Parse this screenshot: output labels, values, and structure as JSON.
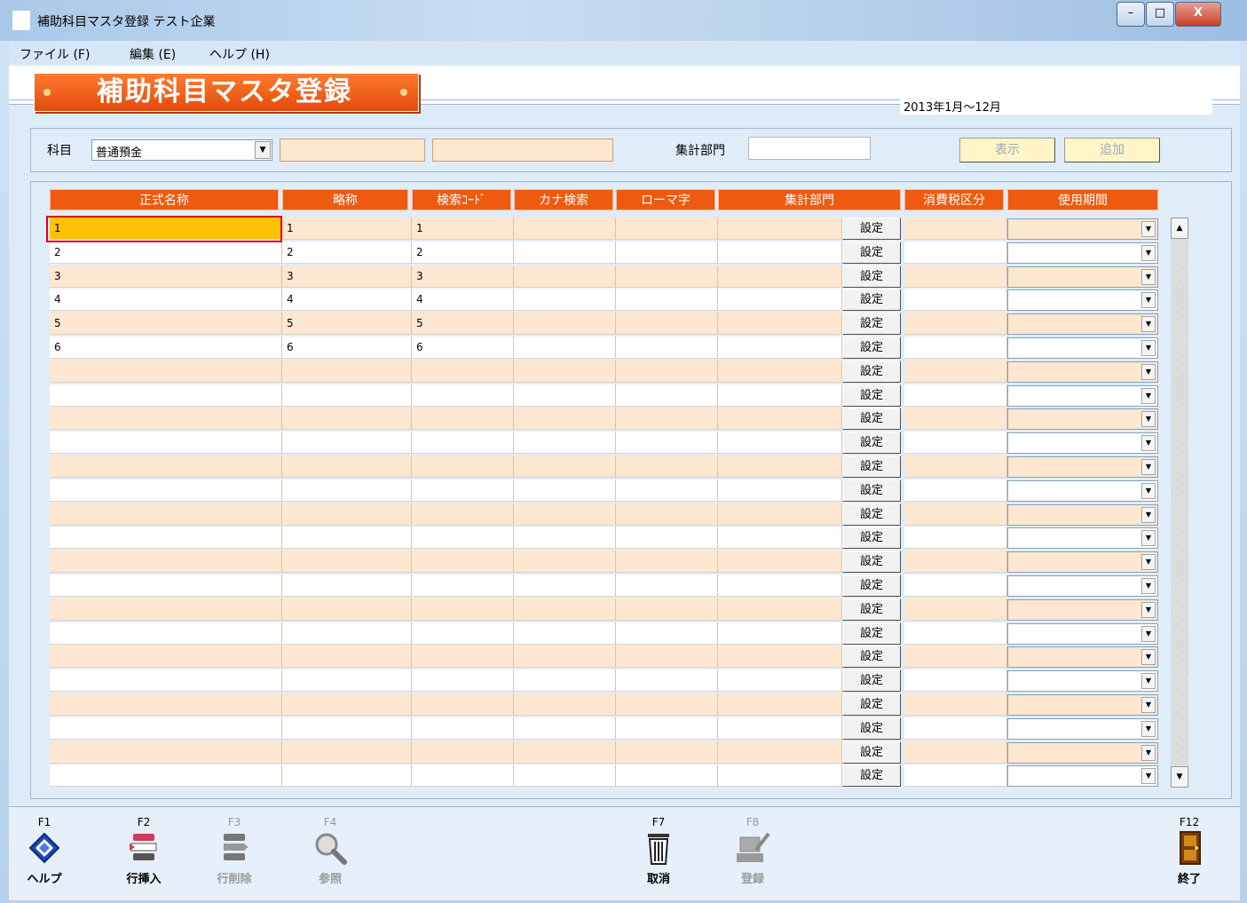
{
  "window": {
    "title": "補助科目マスタ登録 テスト企業",
    "minimize": "–",
    "maximize": "□",
    "close": "X"
  },
  "menu": {
    "file": "ファイル (F)",
    "edit": "編集 (E)",
    "help": "ヘルプ (H)"
  },
  "banner": {
    "title": "補助科目マスタ登録"
  },
  "period": "2013年1月〜12月",
  "filter": {
    "kamoku_label": "科目",
    "kamoku_value": "普通預金",
    "shukei_label": "集計部門",
    "show_button": "表示",
    "add_button": "追加"
  },
  "grid": {
    "headers": [
      "正式名称",
      "略称",
      "検索ｺｰﾄﾞ",
      "カナ検索",
      "ローマ字",
      "集計部門",
      "消費税区分",
      "使用期間"
    ],
    "set_label": "設定",
    "rows": [
      [
        "1",
        "1",
        "1"
      ],
      [
        "2",
        "2",
        "2"
      ],
      [
        "3",
        "3",
        "3"
      ],
      [
        "4",
        "4",
        "4"
      ],
      [
        "5",
        "5",
        "5"
      ],
      [
        "6",
        "6",
        "6"
      ],
      [
        "",
        "",
        ""
      ],
      [
        "",
        "",
        ""
      ],
      [
        "",
        "",
        ""
      ],
      [
        "",
        "",
        ""
      ],
      [
        "",
        "",
        ""
      ],
      [
        "",
        "",
        ""
      ],
      [
        "",
        "",
        ""
      ],
      [
        "",
        "",
        ""
      ],
      [
        "",
        "",
        ""
      ],
      [
        "",
        "",
        ""
      ],
      [
        "",
        "",
        ""
      ],
      [
        "",
        "",
        ""
      ],
      [
        "",
        "",
        ""
      ],
      [
        "",
        "",
        ""
      ],
      [
        "",
        "",
        ""
      ],
      [
        "",
        "",
        ""
      ],
      [
        "",
        "",
        ""
      ],
      [
        "",
        "",
        ""
      ]
    ]
  },
  "fkeys": [
    {
      "key": "F1",
      "label": "ヘルプ",
      "icon": "help-book-icon",
      "enabled": true
    },
    {
      "key": "F2",
      "label": "行挿入",
      "icon": "row-insert-icon",
      "enabled": true
    },
    {
      "key": "F3",
      "label": "行削除",
      "icon": "row-delete-icon",
      "enabled": false
    },
    {
      "key": "F4",
      "label": "参照",
      "icon": "magnifier-icon",
      "enabled": false
    },
    {
      "key": "F7",
      "label": "取消",
      "icon": "trash-icon",
      "enabled": true
    },
    {
      "key": "F8",
      "label": "登録",
      "icon": "register-icon",
      "enabled": false
    },
    {
      "key": "F12",
      "label": "終了",
      "icon": "exit-door-icon",
      "enabled": true
    }
  ]
}
